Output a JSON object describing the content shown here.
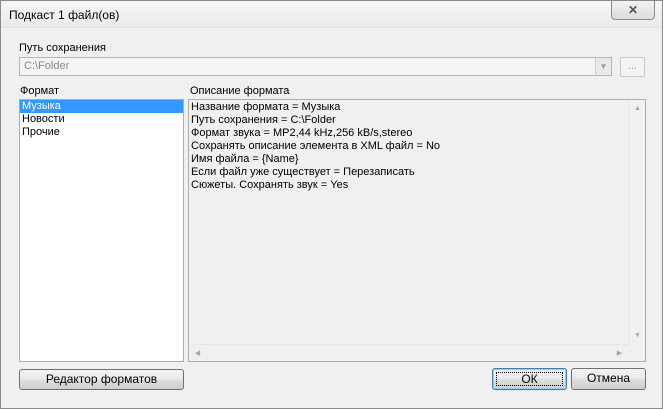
{
  "window": {
    "title": "Подкаст 1 файл(ов)",
    "close_label": "✕"
  },
  "save_path": {
    "label": "Путь сохранения",
    "value": "C:\\Folder",
    "browse_label": "..."
  },
  "format_list": {
    "label": "Формат",
    "items": [
      {
        "label": "Музыка",
        "selected": true
      },
      {
        "label": "Новости",
        "selected": false
      },
      {
        "label": "Прочие",
        "selected": false
      }
    ]
  },
  "description": {
    "label": "Описание формата",
    "lines": [
      "Название формата = Музыка",
      "Путь сохранения = C:\\Folder",
      "Формат звука = MP2,44 kHz,256 kB/s,stereo",
      "Сохранять описание элемента в XML файл = No",
      "Имя файла = {Name}",
      "Если файл уже существует = Перезаписать",
      "Сюжеты. Сохранять звук = Yes"
    ]
  },
  "buttons": {
    "format_editor": "Редактор форматов",
    "ok": "ОК",
    "cancel": "Отмена"
  },
  "icons": {
    "close": "close-icon",
    "dropdown": "chevron-down-icon",
    "scroll_up": "arrow-up-icon",
    "scroll_down": "arrow-down-icon",
    "scroll_left": "arrow-left-icon",
    "scroll_right": "arrow-right-icon"
  },
  "colors": {
    "selection": "#3399ff",
    "window_bg": "#f0f0f0",
    "default_button_border": "#3c7fb1"
  }
}
